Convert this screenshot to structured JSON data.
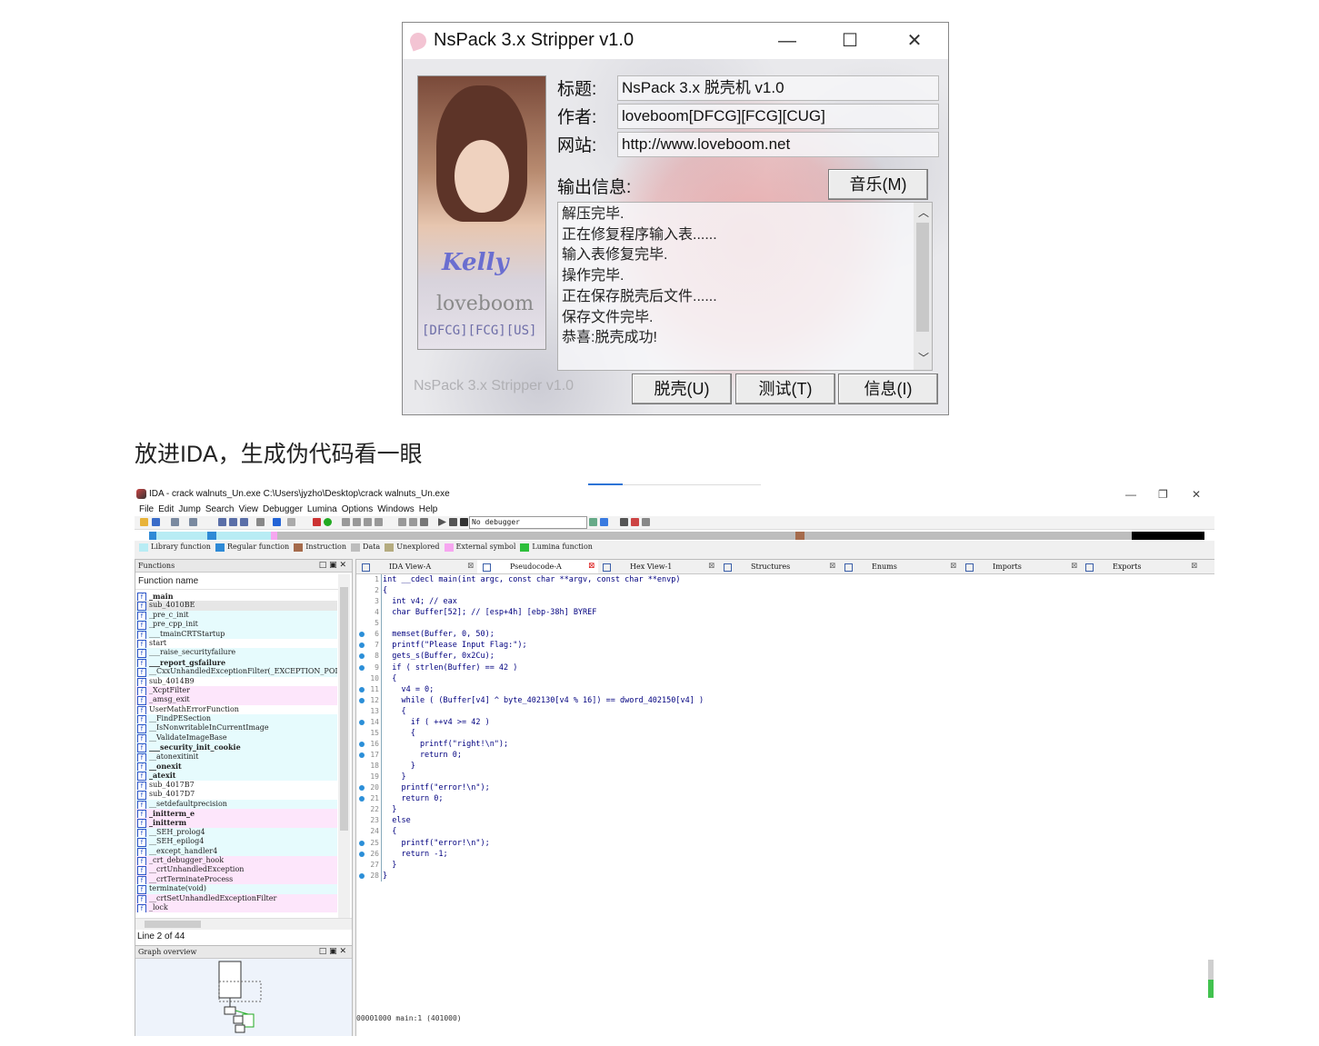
{
  "nspack": {
    "title": "NsPack 3.x Stripper v1.0",
    "controls": {
      "minimize": "—",
      "maximize": "☐",
      "close": "✕"
    },
    "photo": {
      "name": "Kelly",
      "author": "loveboom",
      "groups": "[DFCG][FCG][US]"
    },
    "fields": [
      {
        "label": "标题:",
        "value": "NsPack 3.x 脱壳机 v1.0"
      },
      {
        "label": "作者:",
        "value": "loveboom[DFCG][FCG][CUG]"
      },
      {
        "label": "网站:",
        "value": "http://www.loveboom.net"
      }
    ],
    "output_label": "输出信息:",
    "music_button": "音乐(M)",
    "log": [
      "解压完毕.",
      "正在修复程序输入表......",
      "输入表修复完毕.",
      "操作完毕.",
      "正在保存脱壳后文件......",
      "保存文件完毕.",
      "恭喜:脱壳成功!"
    ],
    "footer": "NsPack 3.x Stripper v1.0",
    "buttons": {
      "unpack": "脱壳(U)",
      "test": "测试(T)",
      "info": "信息(I)"
    }
  },
  "caption": "放进IDA，生成伪代码看一眼",
  "ida": {
    "title": "IDA - crack walnuts_Un.exe C:\\Users\\jyzho\\Desktop\\crack walnuts_Un.exe",
    "controls": {
      "minimize": "—",
      "restore": "❐",
      "close": "✕"
    },
    "menu": [
      "File",
      "Edit",
      "Jump",
      "Search",
      "View",
      "Debugger",
      "Lumina",
      "Options",
      "Windows",
      "Help"
    ],
    "debugger_select": "No debugger",
    "legend": [
      {
        "label": "Library function",
        "color": "#b8ecf4"
      },
      {
        "label": "Regular function",
        "color": "#2e8ad6"
      },
      {
        "label": "Instruction",
        "color": "#a56b4c"
      },
      {
        "label": "Data",
        "color": "#bdbdbd"
      },
      {
        "label": "Unexplored",
        "color": "#b5ac80"
      },
      {
        "label": "External symbol",
        "color": "#f6a6f0"
      },
      {
        "label": "Lumina function",
        "color": "#2dbf3a"
      }
    ],
    "functions_title": "Functions",
    "functions_col": "Function name",
    "functions": [
      {
        "name": "_main",
        "bold": true,
        "color": "#ffffff"
      },
      {
        "name": "sub_4010BE",
        "bold": false,
        "color": "#e6e6e6"
      },
      {
        "name": "_pre_c_init",
        "bold": false,
        "color": "#e6fbfd"
      },
      {
        "name": "_pre_cpp_init",
        "bold": false,
        "color": "#e6fbfd"
      },
      {
        "name": "___tmainCRTStartup",
        "bold": false,
        "color": "#e6fbfd"
      },
      {
        "name": "start",
        "bold": false,
        "color": "#ffffff"
      },
      {
        "name": "___raise_securityfailure",
        "bold": false,
        "color": "#e6fbfd"
      },
      {
        "name": "___report_gsfailure",
        "bold": true,
        "color": "#e6fbfd"
      },
      {
        "name": "__CxxUnhandledExceptionFilter(_EXCEPTION_POI",
        "bold": false,
        "color": "#e6fbfd"
      },
      {
        "name": "sub_4014B9",
        "bold": false,
        "color": "#ffffff"
      },
      {
        "name": "_XcptFilter",
        "bold": false,
        "color": "#fde6fb"
      },
      {
        "name": "_amsg_exit",
        "bold": false,
        "color": "#fde6fb"
      },
      {
        "name": "UserMathErrorFunction",
        "bold": false,
        "color": "#ffffff"
      },
      {
        "name": "__FindPESection",
        "bold": false,
        "color": "#e6fbfd"
      },
      {
        "name": "__IsNonwritableInCurrentImage",
        "bold": false,
        "color": "#e6fbfd"
      },
      {
        "name": "__ValidateImageBase",
        "bold": false,
        "color": "#e6fbfd"
      },
      {
        "name": "___security_init_cookie",
        "bold": true,
        "color": "#e6fbfd"
      },
      {
        "name": "__atonexitinit",
        "bold": false,
        "color": "#e6fbfd"
      },
      {
        "name": "__onexit",
        "bold": true,
        "color": "#e6fbfd"
      },
      {
        "name": "_atexit",
        "bold": true,
        "color": "#e6fbfd"
      },
      {
        "name": "sub_4017B7",
        "bold": false,
        "color": "#ffffff"
      },
      {
        "name": "sub_4017D7",
        "bold": false,
        "color": "#ffffff"
      },
      {
        "name": "__setdefaultprecision",
        "bold": false,
        "color": "#e6fbfd"
      },
      {
        "name": "_initterm_e",
        "bold": true,
        "color": "#fde6fb"
      },
      {
        "name": "_initterm",
        "bold": true,
        "color": "#fde6fb"
      },
      {
        "name": "__SEH_prolog4",
        "bold": false,
        "color": "#e6fbfd"
      },
      {
        "name": "__SEH_epilog4",
        "bold": false,
        "color": "#e6fbfd"
      },
      {
        "name": "__except_handler4",
        "bold": false,
        "color": "#e6fbfd"
      },
      {
        "name": "_crt_debugger_hook",
        "bold": false,
        "color": "#fde6fb"
      },
      {
        "name": "__crtUnhandledException",
        "bold": false,
        "color": "#fde6fb"
      },
      {
        "name": "__crtTerminateProcess",
        "bold": false,
        "color": "#fde6fb"
      },
      {
        "name": "terminate(void)",
        "bold": false,
        "color": "#e6fbfd"
      },
      {
        "name": "__crtSetUnhandledExceptionFilter",
        "bold": false,
        "color": "#fde6fb"
      },
      {
        "name": "_lock",
        "bold": false,
        "color": "#fde6fb"
      }
    ],
    "line_info": "Line 2 of 44",
    "graph_title": "Graph overview",
    "tabs": [
      "IDA View-A",
      "Pseudocode-A",
      "Hex View-1",
      "Structures",
      "Enums",
      "Imports",
      "Exports"
    ],
    "code_lines": [
      "int __cdecl main(int argc, const char **argv, const char **envp)",
      "{",
      "  int v4; // eax",
      "  char Buffer[52]; // [esp+4h] [ebp-38h] BYREF",
      "",
      "  memset(Buffer, 0, 50);",
      "  printf(\"Please Input Flag:\");",
      "  gets_s(Buffer, 0x2Cu);",
      "  if ( strlen(Buffer) == 42 )",
      "  {",
      "    v4 = 0;",
      "    while ( (Buffer[v4] ^ byte_402130[v4 % 16]) == dword_402150[v4] )",
      "    {",
      "      if ( ++v4 >= 42 )",
      "      {",
      "        printf(\"right!\\n\");",
      "        return 0;",
      "      }",
      "    }",
      "    printf(\"error!\\n\");",
      "    return 0;",
      "  }",
      "  else",
      "  {",
      "    printf(\"error!\\n\");",
      "    return -1;",
      "  }",
      "}"
    ],
    "breakpoint_lines": [
      6,
      7,
      8,
      9,
      11,
      12,
      14,
      16,
      17,
      20,
      21,
      25,
      26,
      28
    ],
    "status": "00001000 main:1 (401000)"
  }
}
